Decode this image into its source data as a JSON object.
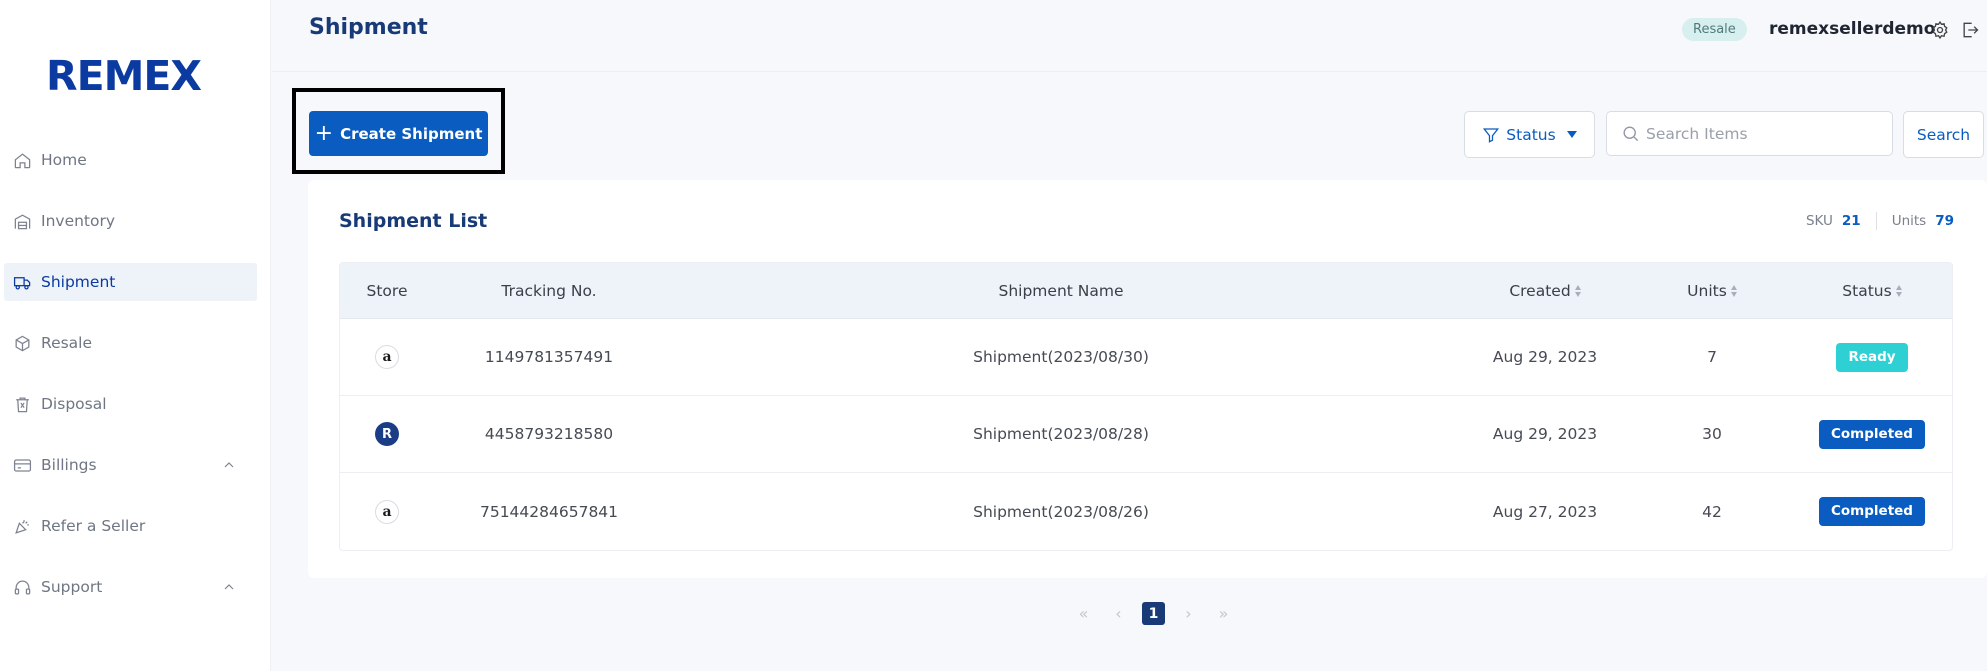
{
  "brand": {
    "logo_text": "REMEX"
  },
  "sidebar": {
    "items": [
      {
        "label": "Home",
        "icon": "home-icon",
        "active": false
      },
      {
        "label": "Inventory",
        "icon": "warehouse-icon",
        "active": false
      },
      {
        "label": "Shipment",
        "icon": "truck-icon",
        "active": true
      },
      {
        "label": "Resale",
        "icon": "box-icon",
        "active": false
      },
      {
        "label": "Disposal",
        "icon": "trash-icon",
        "active": false
      },
      {
        "label": "Billings",
        "icon": "credit-card-icon",
        "active": false,
        "expandable": true
      },
      {
        "label": "Refer a Seller",
        "icon": "party-popper-icon",
        "active": false
      },
      {
        "label": "Support",
        "icon": "headset-icon",
        "active": false,
        "expandable": true
      }
    ]
  },
  "header": {
    "title": "Shipment",
    "badge": "Resale",
    "username": "remexsellerdemo"
  },
  "toolbar": {
    "create_label": "Create Shipment",
    "status_label": "Status",
    "search_placeholder": "Search Items",
    "search_label": "Search"
  },
  "list": {
    "title": "Shipment List",
    "sku_label": "SKU",
    "sku_value": "21",
    "units_label": "Units",
    "units_value": "79",
    "columns": [
      "Store",
      "Tracking No.",
      "Shipment Name",
      "Created",
      "Units",
      "Status"
    ],
    "rows": [
      {
        "store": "amazon",
        "store_glyph": "a",
        "tracking": "1149781357491",
        "name": "Shipment(2023/08/30)",
        "created": "Aug 29, 2023",
        "units": "7",
        "status": "Ready"
      },
      {
        "store": "remex",
        "store_glyph": "R",
        "tracking": "4458793218580",
        "name": "Shipment(2023/08/28)",
        "created": "Aug 29, 2023",
        "units": "30",
        "status": "Completed"
      },
      {
        "store": "amazon",
        "store_glyph": "a",
        "tracking": "75144284657841",
        "name": "Shipment(2023/08/26)",
        "created": "Aug 27, 2023",
        "units": "42",
        "status": "Completed"
      }
    ]
  },
  "pagination": {
    "current_page": "1",
    "first": "«",
    "prev": "‹",
    "next": "›",
    "last": "»"
  },
  "colors": {
    "primary": "#0a5cc0",
    "navy": "#183a77",
    "ready": "#2fd0d3"
  }
}
